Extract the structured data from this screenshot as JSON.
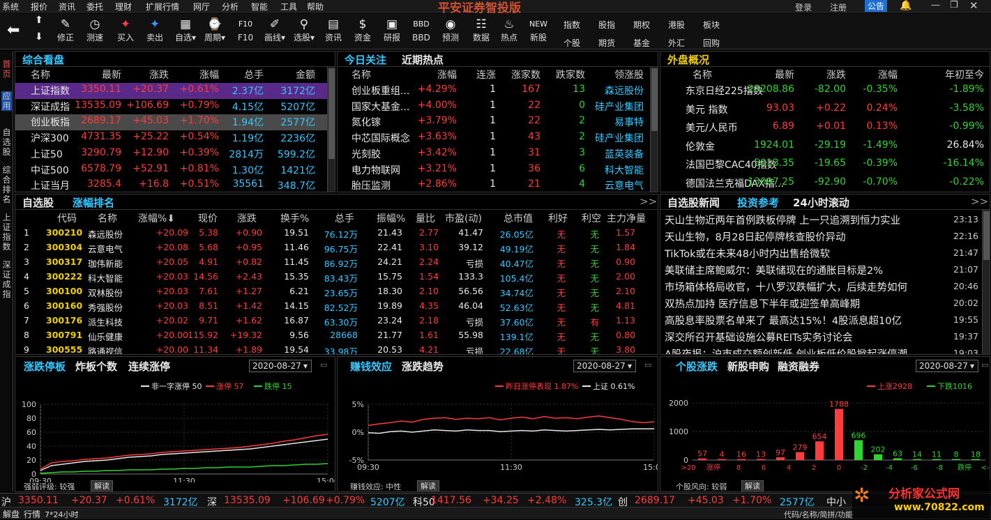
{
  "menu": [
    "系统",
    "报价",
    "资讯",
    "委托",
    "理财",
    "扩展行情",
    "网厅",
    "分析",
    "智能",
    "工具",
    "帮助"
  ],
  "app_title": "平安证券智投版",
  "top_right": {
    "login": "登录",
    "register": "注册",
    "notice": "公告"
  },
  "toolbar": [
    {
      "label": "修正",
      "icon": "edit-icon",
      "glyph": "✎"
    },
    {
      "label": "测速",
      "icon": "speed-icon",
      "glyph": "◷"
    },
    {
      "label": "买入",
      "icon": "buy-icon",
      "glyph": "✦"
    },
    {
      "label": "卖出",
      "icon": "sell-icon",
      "glyph": "✦"
    },
    {
      "label": "自选▾",
      "icon": "favorite-icon",
      "glyph": "▦"
    },
    {
      "label": "周期▾",
      "icon": "period-icon",
      "glyph": "⌚"
    },
    {
      "label": "F10",
      "icon": "f10-icon",
      "glyph": "F10"
    },
    {
      "label": "画线▾",
      "icon": "draw-line-icon",
      "glyph": "✐"
    },
    {
      "label": "选股▾",
      "icon": "stock-select-icon",
      "glyph": "⚲"
    },
    {
      "label": "资讯",
      "icon": "news-icon",
      "glyph": "▤"
    },
    {
      "label": "资金",
      "icon": "fund-icon",
      "glyph": "$"
    },
    {
      "label": "研报",
      "icon": "report-icon",
      "glyph": "▣"
    },
    {
      "label": "BBD",
      "icon": "bbd-icon",
      "glyph": "BBD"
    },
    {
      "label": "预测",
      "icon": "forecast-icon",
      "glyph": "◉"
    },
    {
      "label": "数据",
      "icon": "data-icon",
      "glyph": "☷"
    },
    {
      "label": "热点",
      "icon": "hot-icon",
      "glyph": "♨"
    },
    {
      "label": "新股",
      "icon": "new-stock-icon",
      "glyph": "NEW"
    }
  ],
  "toolbar2": [
    [
      "指数",
      "个股"
    ],
    [
      "股指",
      "期货"
    ],
    [
      "期权",
      "基金"
    ],
    [
      "港股",
      "外汇"
    ],
    [
      "板块",
      "回购"
    ]
  ],
  "leftbar": [
    "首页",
    "应用",
    "自选股",
    "综合排名",
    "上证指数",
    "深证成指"
  ],
  "overview": {
    "title": "综合看盘",
    "headers": [
      "名称",
      "最新",
      "涨跌",
      "涨幅",
      "总手",
      "金额"
    ],
    "rows": [
      [
        "上证指数",
        "3350.11",
        "+20.37",
        "+0.61%",
        "2.37亿",
        "3172亿"
      ],
      [
        "深证成指",
        "13535.09",
        "+106.69",
        "+0.79%",
        "4.15亿",
        "5207亿"
      ],
      [
        "创业板指",
        "2689.17",
        "+45.03",
        "+1.70%",
        "1.94亿",
        "2577亿"
      ],
      [
        "沪深300",
        "4731.35",
        "+25.22",
        "+0.54%",
        "1.19亿",
        "2236亿"
      ],
      [
        "上证50",
        "3290.79",
        "+12.90",
        "+0.39%",
        "2814万",
        "599.2亿"
      ],
      [
        "中证500",
        "6578.79",
        "+52.91",
        "+0.81%",
        "1.30亿",
        "1421亿"
      ],
      [
        "上证当月",
        "3285.4",
        "+16.8",
        "+0.51%",
        "35561",
        "348.7亿"
      ]
    ]
  },
  "focus": {
    "tabs": [
      "今日关注",
      "近期热点"
    ],
    "headers": [
      "名称",
      "涨幅",
      "连涨",
      "涨家数",
      "跌家数",
      "领涨股"
    ],
    "rows": [
      [
        "创业板重组...",
        "+4.29%",
        "1",
        "167",
        "13",
        "森远股份"
      ],
      [
        "国家大基金...",
        "+4.00%",
        "1",
        "22",
        "0",
        "硅产业集团"
      ],
      [
        "氮化镓",
        "+3.79%",
        "1",
        "22",
        "2",
        "易事特"
      ],
      [
        "中芯国际概念",
        "+3.63%",
        "1",
        "43",
        "2",
        "硅产业集团"
      ],
      [
        "光刻胶",
        "+3.42%",
        "1",
        "31",
        "3",
        "蓝英装备"
      ],
      [
        "电力物联网",
        "+3.21%",
        "1",
        "36",
        "6",
        "科大智能"
      ],
      [
        "胎压监测",
        "+2.86%",
        "1",
        "21",
        "4",
        "云意电气"
      ]
    ]
  },
  "global": {
    "title": "外盘概况",
    "headers": [
      "名称",
      "最新",
      "涨跌",
      "涨幅",
      "年初至今"
    ],
    "rows": [
      [
        "东京日经225指数",
        "23208.86",
        "-82.00",
        "-0.35%",
        "-1.89%"
      ],
      [
        "美元 指数",
        "93.03",
        "+0.22",
        "0.24%",
        "-3.58%"
      ],
      [
        "美元/人民币",
        "6.89",
        "+0.01",
        "0.13%",
        "-0.99%"
      ],
      [
        "伦敦金",
        "1924.01",
        "-29.19",
        "-1.49%",
        "26.84%"
      ],
      [
        "法国巴黎CAC40指数",
        "5013.35",
        "-19.65",
        "-0.39%",
        "-16.14%"
      ],
      [
        "德国法兰克福DAX指...",
        "13097.25",
        "-92.90",
        "-0.70%",
        "-0.22%"
      ]
    ]
  },
  "watch": {
    "tabs": [
      "自选股",
      "涨幅排名"
    ],
    "more": ">>",
    "headers": [
      "代码",
      "名称",
      "涨幅%⬇",
      "现价",
      "涨跌",
      "换手%",
      "总手",
      "振幅%",
      "量比",
      "市盈(动)",
      "总市值",
      "利好",
      "利空",
      "主力净量"
    ],
    "rows": [
      [
        "1",
        "300210",
        "森远股份",
        "+20.09",
        "5.38",
        "+0.90",
        "19.51",
        "76.12万",
        "21.43",
        "2.77",
        "41.47",
        "26.05亿",
        "无",
        "无",
        "1.57"
      ],
      [
        "2",
        "300304",
        "云意电气",
        "+20.08",
        "5.68",
        "+0.95",
        "11.46",
        "96.75万",
        "22.41",
        "3.10",
        "39.12",
        "49.19亿",
        "无",
        "无",
        "1.84"
      ],
      [
        "3",
        "300317",
        "珈伟新能",
        "+20.05",
        "4.91",
        "+0.82",
        "11.45",
        "86.92万",
        "24.21",
        "2.24",
        "亏损",
        "40.47亿",
        "无",
        "无",
        "0.90"
      ],
      [
        "4",
        "300222",
        "科大智能",
        "+20.03",
        "14.56",
        "+2.43",
        "15.35",
        "83.43万",
        "15.75",
        "1.54",
        "133.3",
        "105.4亿",
        "无",
        "无",
        "2.00"
      ],
      [
        "5",
        "300100",
        "双林股份",
        "+20.03",
        "7.61",
        "+1.27",
        "6.21",
        "23.65万",
        "18.30",
        "2.10",
        "56.56",
        "34.74亿",
        "无",
        "无",
        "2.10"
      ],
      [
        "6",
        "300160",
        "秀强股份",
        "+20.03",
        "8.51",
        "+1.42",
        "14.15",
        "82.52万",
        "19.89",
        "4.35",
        "46.04",
        "52.63亿",
        "无",
        "无",
        "4.81"
      ],
      [
        "7",
        "300176",
        "派生科技",
        "+20.02",
        "9.71",
        "+1.62",
        "16.87",
        "63.30万",
        "23.24",
        "2.18",
        "亏损",
        "37.60亿",
        "无",
        "有",
        "1.13"
      ],
      [
        "8",
        "300791",
        "仙乐健康",
        "+20.00",
        "115.92",
        "+19.32",
        "9.56",
        "28668",
        "21.77",
        "1.61",
        "55.98",
        "139.1亿",
        "无",
        "无",
        "0.80"
      ],
      [
        "9",
        "300555",
        "路通视信",
        "+20.00",
        "11.34",
        "+1.89",
        "19.54",
        "33.98万",
        "20.53",
        "4.21",
        "亏损",
        "22.68亿",
        "无",
        "无",
        "3.80"
      ]
    ]
  },
  "news": {
    "tabs": [
      "自选股新闻",
      "投资参考",
      "24小时滚动"
    ],
    "more": ">>",
    "items": [
      [
        "天山生物近两年首例跌板停牌 上一只追溯到恒力实业",
        "23:13"
      ],
      [
        "天山生物，8月28日起停牌核查股价异动",
        "22:16"
      ],
      [
        "TikTok或在未来48小时内出售给微软",
        "21:47"
      ],
      [
        "美联储主席鲍威尔：美联储现在的通胀目标是2%",
        "21:07"
      ],
      [
        "市场箱体格局收官，十八罗汉跌幅扩大，后续走势如何",
        "20:46"
      ],
      [
        "双热点加持 医疗信息下半年或迎签单高峰期",
        "20:02"
      ],
      [
        "高股息率股票名单来了 最高达15%！4股派息超10亿",
        "19:55"
      ],
      [
        "深交所召开基础设施公募REITs实务讨论会",
        "19:37"
      ],
      [
        "A股夜报：沪市成交额创新低 创业板低价股掀起涨停潮",
        "19:03"
      ]
    ]
  },
  "chart1": {
    "tabs": [
      "涨跌停板",
      "炸板个数",
      "连续涨停"
    ],
    "date": "2020-08-27",
    "footer_label": "强弱评级: 较强",
    "btn": "解读"
  },
  "chart2": {
    "tabs": [
      "赚钱效应",
      "涨跌趋势"
    ],
    "date": "2020-08-27",
    "footer_label": "赚钱效应: 中性",
    "btn": "解读"
  },
  "chart3": {
    "tabs": [
      "个股涨跌",
      "新股申购",
      "融资融券"
    ],
    "date": "2020-08-27",
    "footer_label": "个股风向: 较弱",
    "btn": "解读"
  },
  "chart_data": [
    {
      "type": "line",
      "x": [
        "09:30",
        "11:30",
        "15:00"
      ],
      "ylim": [
        0,
        100
      ],
      "yticks": [
        0,
        20,
        40,
        60,
        80,
        100
      ],
      "series": [
        {
          "name": "非一字涨停 50",
          "color": "#e8e8e8",
          "values": [
            5,
            12,
            14,
            16,
            18,
            19,
            20,
            22,
            24,
            25,
            26,
            28,
            29,
            30,
            31,
            32,
            33,
            34,
            35,
            36,
            38,
            40,
            42,
            44,
            46,
            48,
            50
          ]
        },
        {
          "name": "涨停 57",
          "color": "#ff3b3b",
          "values": [
            7,
            16,
            18,
            19,
            21,
            22,
            23,
            25,
            27,
            28,
            29,
            31,
            32,
            33,
            34,
            35,
            36,
            37,
            38,
            40,
            42,
            44,
            47,
            49,
            52,
            55,
            57
          ]
        },
        {
          "name": "跌停 15",
          "color": "#2fd52f",
          "values": [
            1,
            2,
            3,
            3,
            4,
            4,
            5,
            5,
            6,
            6,
            6,
            7,
            7,
            8,
            8,
            9,
            9,
            10,
            10,
            10,
            11,
            12,
            12,
            13,
            14,
            14,
            15
          ]
        }
      ]
    },
    {
      "type": "line",
      "x": [
        "09:30",
        "11:30",
        "15:00"
      ],
      "ylim": [
        -5,
        5
      ],
      "yticks": [
        "-5%",
        "0%",
        "5%"
      ],
      "series": [
        {
          "name": "昨日涨停表现 1.87%",
          "color": "#ff3b3b",
          "values": [
            1.2,
            1.5,
            1.7,
            2.0,
            1.8,
            2.3,
            2.5,
            2.6,
            2.3,
            2.5,
            2.4,
            2.6,
            2.2,
            2.5,
            2.7,
            2.4,
            2.8,
            2.5,
            2.6,
            2.4,
            2.7,
            2.9,
            2.6,
            2.3,
            1.9,
            1.7,
            1.87
          ]
        },
        {
          "name": "上证 0.61%",
          "color": "#e8e8e8",
          "values": [
            -0.1,
            -0.2,
            0.1,
            0.2,
            0.0,
            0.2,
            0.4,
            0.3,
            0.2,
            0.4,
            0.3,
            0.3,
            0.1,
            0.2,
            0.3,
            0.2,
            0.4,
            0.3,
            0.2,
            0.3,
            0.4,
            0.5,
            0.4,
            0.5,
            0.6,
            0.6,
            0.61
          ]
        }
      ]
    },
    {
      "type": "bar",
      "categories": [
        ">20",
        "涨停",
        "",
        "",
        "",
        "",
        "",
        "",
        "",
        "",
        "",
        "",
        "",
        "",
        "",
        "",
        "跌停",
        "<-20"
      ],
      "ylim": [
        0,
        2000
      ],
      "yticks": [
        0,
        1000,
        2000
      ],
      "legend": [
        "上涨2928",
        "下跌1016"
      ],
      "values": [
        57,
        4,
        16,
        13,
        97,
        279,
        654,
        1788,
        696,
        202,
        63,
        14,
        11,
        8,
        18,
        0,
        0,
        0
      ],
      "labels": [
        "57",
        "4",
        "16",
        "13",
        "97",
        "279",
        "654",
        "1788",
        "696",
        "202",
        "63",
        "14",
        "11",
        "8",
        "18",
        "",
        "",
        ""
      ],
      "colors": [
        "#ff3b3b",
        "#ff3b3b",
        "#ff3b3b",
        "#ff3b3b",
        "#ff3b3b",
        "#ff3b3b",
        "#ff3b3b",
        "#ff3b3b",
        "#2fd52f",
        "#2fd52f",
        "#2fd52f",
        "#2fd52f",
        "#2fd52f",
        "#2fd52f",
        "#2fd52f",
        "#2fd52f",
        "#2fd52f",
        "#2fd52f"
      ],
      "axis_labels": [
        ">20",
        "涨停",
        "8",
        "6",
        "4",
        "2",
        "0",
        "-2",
        "-4",
        "-6",
        "-8",
        "跌停",
        "<-20"
      ]
    }
  ],
  "statusbar": [
    {
      "label": "沪",
      "v1": "3350.11",
      "v2": "+20.37",
      "v3": "+0.61%",
      "v4": "3172亿"
    },
    {
      "label": "深",
      "v1": "13535.09",
      "v2": "+106.69",
      "v3": "+0.79%",
      "v4": "5207亿"
    },
    {
      "label": "科50",
      "v1": "1417.56",
      "v2": "+34.25",
      "v3": "+2.48%",
      "v4": "325.3亿"
    },
    {
      "label": "创",
      "v1": "2689.17",
      "v2": "+45.03",
      "v3": "+1.70%",
      "v4": "2577亿"
    }
  ],
  "statusbar_tail": "中小",
  "statusbar2": [
    "解盘",
    "行情",
    "7*24小时"
  ],
  "search_hint": "代码/名称/简拼/功能",
  "watermark": "分析家公式网",
  "watermark_url": "www.70822.com"
}
